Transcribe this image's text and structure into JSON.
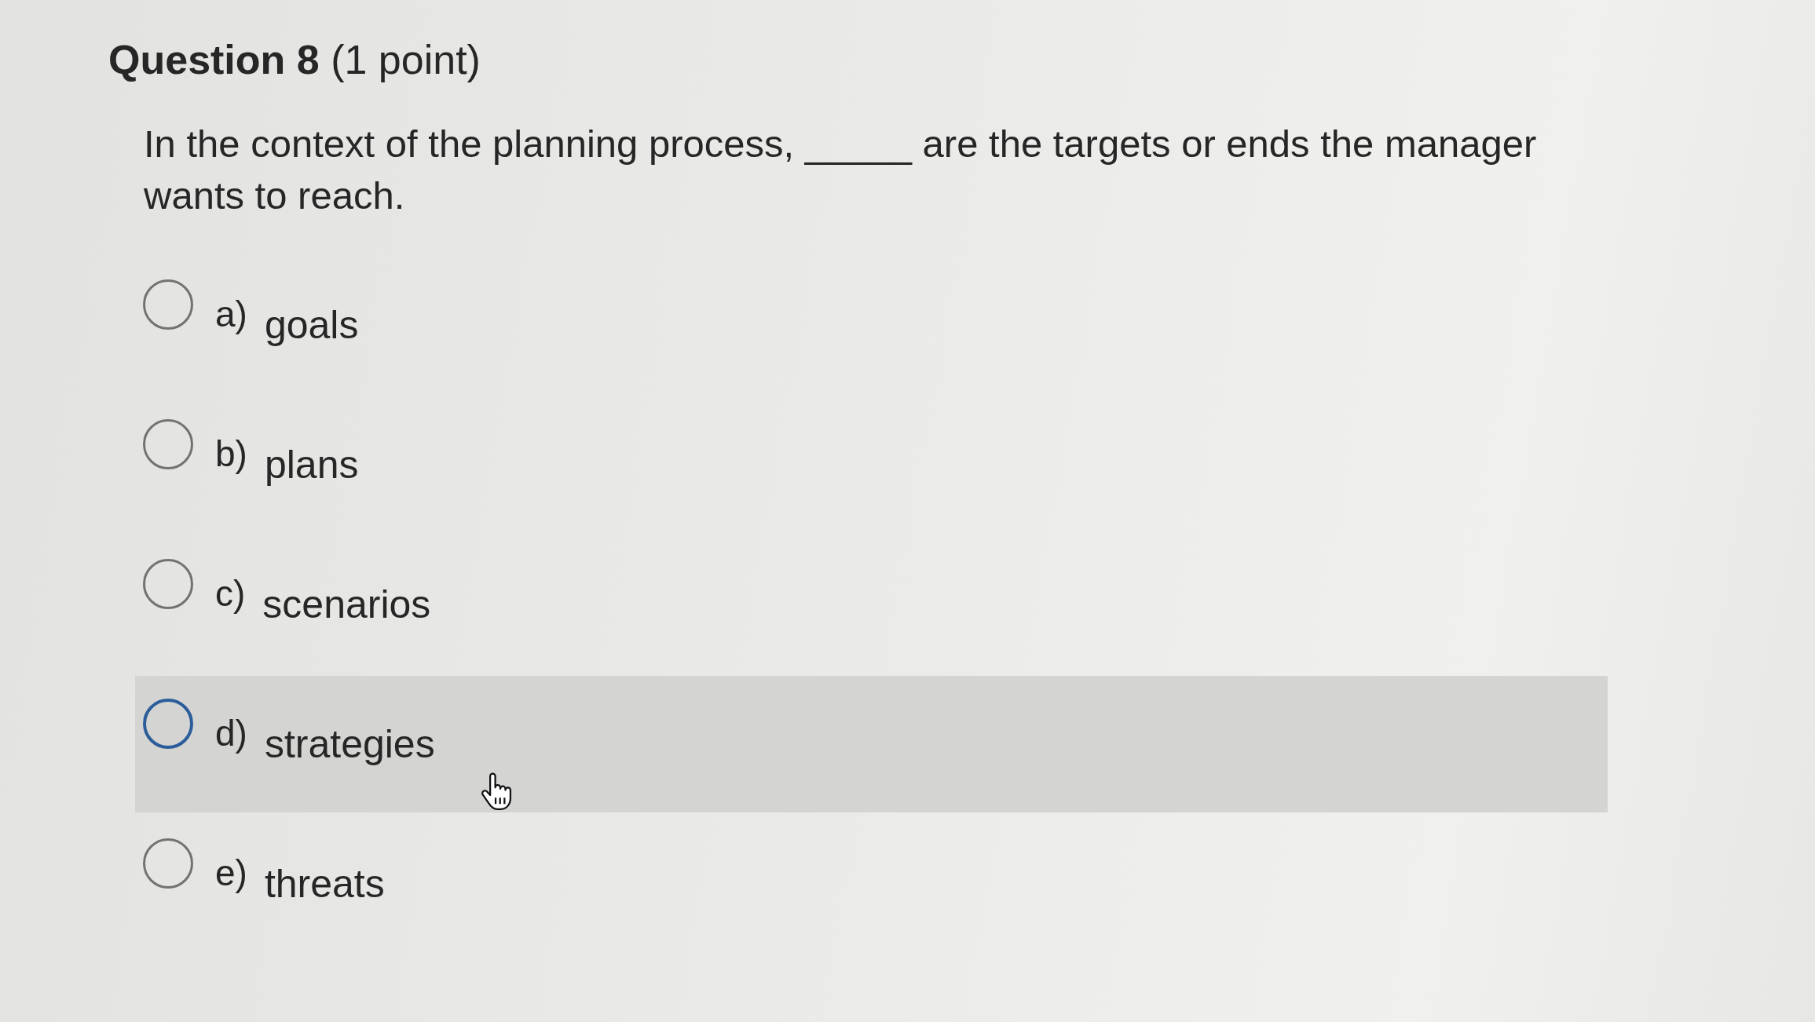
{
  "question": {
    "title": "**Question 8** (1 point)",
    "prompt": "In the context of the planning process, _____ are the targets or ends the manager wants to reach."
  },
  "options": [
    {
      "letter": "a)",
      "text": "goals",
      "selected": false,
      "hovered": false
    },
    {
      "letter": "b)",
      "text": "plans",
      "selected": false,
      "hovered": false
    },
    {
      "letter": "c)",
      "text": "scenarios",
      "selected": false,
      "hovered": false
    },
    {
      "letter": "d)",
      "text": "strategies",
      "selected": false,
      "hovered": true
    },
    {
      "letter": "e)",
      "text": "threats",
      "selected": false,
      "hovered": false
    }
  ]
}
